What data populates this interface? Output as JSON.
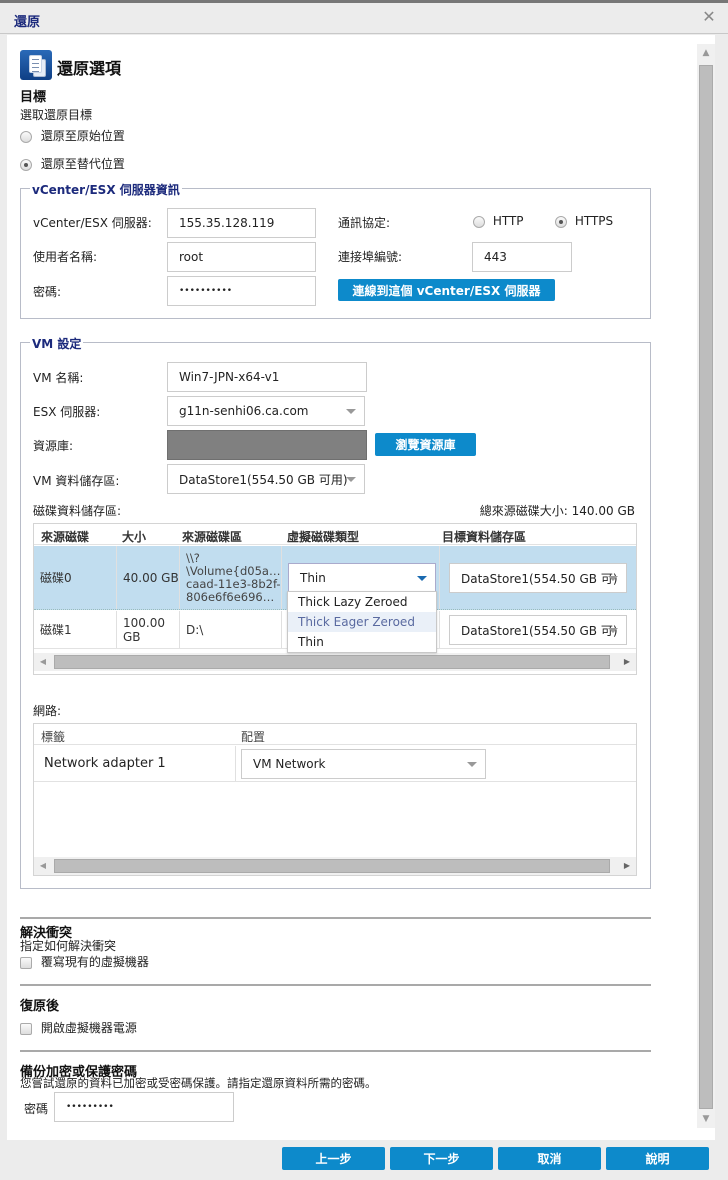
{
  "window": {
    "title": "還原"
  },
  "header": {
    "title": "還原選項",
    "icon": "restore-document-icon"
  },
  "destination": {
    "section_title": "目標",
    "subtitle": "選取還原目標",
    "options": [
      {
        "label": "還原至原始位置",
        "selected": false
      },
      {
        "label": "還原至替代位置",
        "selected": true
      }
    ]
  },
  "vcenter": {
    "legend": "vCenter/ESX 伺服器資訊",
    "server_label": "vCenter/ESX 伺服器:",
    "server_value": "155.35.128.119",
    "user_label": "使用者名稱:",
    "user_value": "root",
    "password_label": "密碼:",
    "password_value": "••••••••••",
    "protocol_label": "通訊協定:",
    "protocols": [
      {
        "label": "HTTP",
        "selected": false
      },
      {
        "label": "HTTPS",
        "selected": true
      }
    ],
    "port_label": "連接埠編號:",
    "port_value": "443",
    "connect_button": "連線到這個 vCenter/ESX 伺服器"
  },
  "vm": {
    "legend": "VM 設定",
    "name_label": "VM 名稱:",
    "name_value": "Win7-JPN-x64-v1",
    "esx_label": "ESX 伺服器:",
    "esx_value": "g11n-senhi06.ca.com",
    "pool_label": "資源庫:",
    "pool_value": "",
    "browse_pool_button": "瀏覽資源庫",
    "datastore_label": "VM 資料儲存區:",
    "datastore_value": "DataStore1(554.50 GB 可用)",
    "disk_ds_label": "磁碟資料儲存區:",
    "total_size_label": "總來源磁碟大小: 140.00 GB",
    "disk_table": {
      "columns": [
        "來源磁碟",
        "大小",
        "來源磁碟區",
        "虛擬磁碟類型",
        "目標資料儲存區"
      ],
      "rows": [
        {
          "disk": "磁碟0",
          "size": "40.00 GB",
          "volume": "\\\\?\\Volume{d05a…caad-11e3-8b2f-806e6f6e696…",
          "volume_lines": [
            "\\\\?",
            "\\Volume{d05a…",
            "caad-11e3-8b2f-",
            "806e6f6e696…"
          ],
          "type": "Thin",
          "target": "DataStore1(554.50 GB 可)",
          "selected": true
        },
        {
          "disk": "磁碟1",
          "size": "100.00 GB",
          "size_lines": [
            "100.00",
            "GB"
          ],
          "volume": "D:\\",
          "type": "",
          "target": "DataStore1(554.50 GB 可)",
          "selected": false
        }
      ],
      "type_dropdown_options": [
        "Thick Lazy Zeroed",
        "Thick Eager Zeroed",
        "Thin"
      ],
      "type_dropdown_highlighted": "Thick Eager Zeroed"
    },
    "network_label": "網路:",
    "network_table": {
      "columns": [
        "標籤",
        "配置"
      ],
      "rows": [
        {
          "label": "Network adapter 1",
          "config": "VM Network"
        }
      ]
    }
  },
  "conflict": {
    "title": "解決衝突",
    "subtitle": "指定如何解決衝突",
    "overwrite_label": "覆寫現有的虛擬機器",
    "overwrite_checked": false
  },
  "post_restore": {
    "title": "復原後",
    "power_on_label": "開啟虛擬機器電源",
    "power_on_checked": false
  },
  "encryption": {
    "title": "備份加密或保護密碼",
    "description": "您嘗試還原的資料已加密或受密碼保護。請指定還原資料所需的密碼。",
    "password_label": "密碼",
    "password_value": "•••••••••"
  },
  "footer": {
    "prev": "上一步",
    "next": "下一步",
    "cancel": "取消",
    "help": "說明"
  },
  "colors": {
    "accent": "#0d8acb",
    "title": "#1c2a7c",
    "selected_row": "#c1ddef"
  }
}
